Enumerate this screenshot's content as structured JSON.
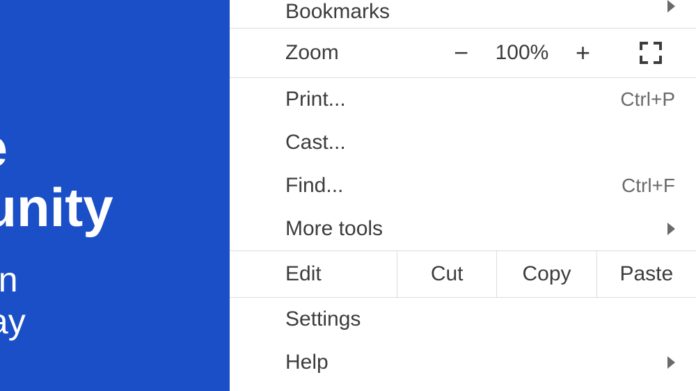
{
  "sidebar": {
    "heading_line1": "he",
    "heading_line2": "rtunity",
    "sub_line1": "sson",
    "sub_line2": "eway"
  },
  "menu": {
    "bookmarks": "Bookmarks",
    "zoom": {
      "label": "Zoom",
      "minus": "−",
      "percent": "100%",
      "plus": "+"
    },
    "print": {
      "label": "Print...",
      "shortcut": "Ctrl+P"
    },
    "cast": "Cast...",
    "find": {
      "label": "Find...",
      "shortcut": "Ctrl+F"
    },
    "more_tools": "More tools",
    "edit": {
      "label": "Edit",
      "cut": "Cut",
      "copy": "Copy",
      "paste": "Paste"
    },
    "settings": "Settings",
    "help": "Help"
  }
}
